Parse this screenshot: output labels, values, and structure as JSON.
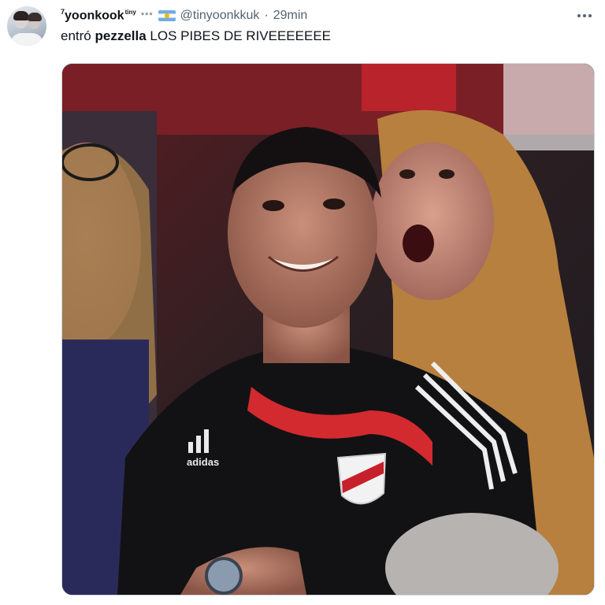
{
  "tweet": {
    "display_name": "yoonkook",
    "name_prefix": "7",
    "name_suffix": "tiny",
    "stars": "***",
    "handle": "@tinyoonkkuk",
    "separator": "·",
    "time": "29min",
    "text_start": "entró ",
    "text_bold": "pezzella",
    "text_end": " LOS PIBES DE RIVEEEEEEE"
  },
  "photo": {
    "logo_letters": "adidas"
  }
}
